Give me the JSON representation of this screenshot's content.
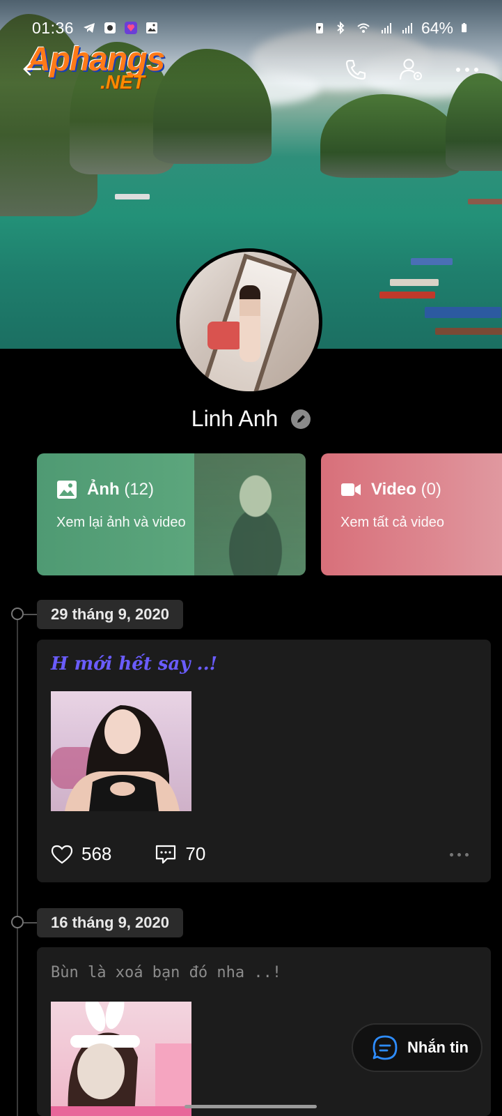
{
  "status_bar": {
    "time": "01:36",
    "battery": "64%"
  },
  "logo": {
    "word": "Aphangs",
    "suffix": ".NET"
  },
  "profile": {
    "name": "Linh Anh"
  },
  "cards": {
    "photos": {
      "label": "Ảnh",
      "count": "(12)",
      "subtitle": "Xem lại ảnh và video"
    },
    "videos": {
      "label": "Video",
      "count": "(0)",
      "subtitle": "Xem tất cả video"
    }
  },
  "posts": [
    {
      "date": "29 tháng 9, 2020",
      "caption": "H mới hết say ..!",
      "likes": "568",
      "comments": "70"
    },
    {
      "date": "16 tháng 9, 2020",
      "caption": "Bùn là xoá bạn đó nha ..!"
    }
  ],
  "fab": {
    "label": "Nhắn tin"
  },
  "colors": {
    "photos_card": "#5aa47b",
    "videos_card": "#dd8790",
    "caption_accent": "#6a5cff",
    "fab_icon": "#2e8dff"
  },
  "icons": [
    "back-arrow-icon",
    "phone-icon",
    "user-settings-icon",
    "more-icon",
    "edit-icon",
    "image-icon",
    "video-icon",
    "heart-icon",
    "comment-icon",
    "chat-icon"
  ]
}
